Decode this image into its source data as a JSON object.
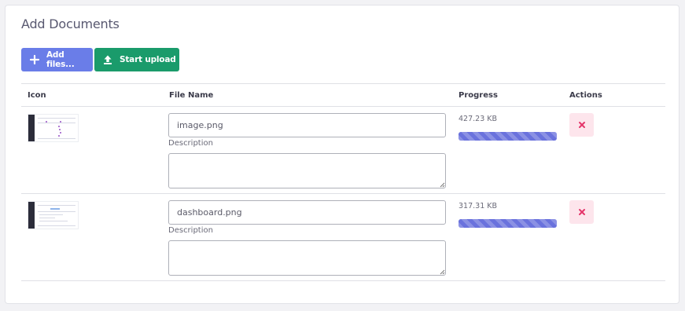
{
  "card": {
    "title": "Add Documents"
  },
  "toolbar": {
    "add_label": "Add files...",
    "upload_label": "Start upload",
    "add_color": "#6a7de8",
    "upload_color": "#1a9b6b"
  },
  "table": {
    "headers": [
      "Icon",
      "File Name",
      "Progress",
      "Actions"
    ],
    "rows": [
      {
        "thumbnail_icon": "image-thumbnail",
        "file_name": "image.png",
        "description_label": "Description",
        "description": "",
        "size": "427.23 KB",
        "progress": 1.0,
        "delete_icon": "close-icon"
      },
      {
        "thumbnail_icon": "image-thumbnail",
        "file_name": "dashboard.png",
        "description_label": "Description",
        "description": "",
        "size": "317.31 KB",
        "progress": 1.0,
        "delete_icon": "close-icon"
      }
    ]
  },
  "colors": {
    "progress": "#6a72dd",
    "delete_bg": "#fde5ec",
    "delete_icon": "#e4356a"
  }
}
